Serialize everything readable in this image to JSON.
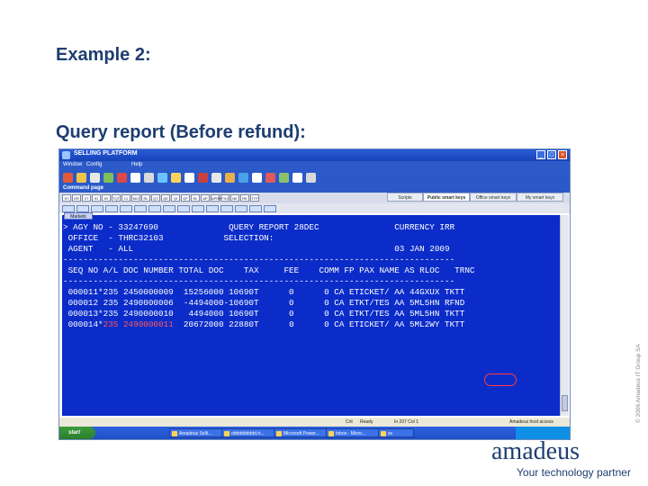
{
  "slide": {
    "title": "Example 2:",
    "subtitle": "Query report (Before refund):",
    "copyright": "© 2006 Amadeus IT Group SA",
    "logo": "amadeus",
    "tagline": "Your technology partner"
  },
  "window": {
    "title": "SELLING PLATFORM",
    "menu": [
      "Window",
      "Config",
      "Help"
    ],
    "command_page": "Command page",
    "function_keys": [
      "ST",
      "ER",
      "XT",
      "IG",
      "IR",
      "TQT",
      "CI",
      "MO",
      "RL",
      "QT",
      "QE",
      "QI",
      "QF",
      "RL",
      "AP",
      "APRK",
      "FXX",
      "NE",
      "RE",
      "TTP"
    ],
    "tabs": [
      "Scripts",
      "Public smart keys",
      "Office smart keys",
      "My smart keys"
    ],
    "subtab": "Markets",
    "terminal_lines": [
      "> AGY NO - 33247690              QUERY REPORT 28DEC               CURRENCY IRR",
      " OFFICE  - THRC32103            SELECTION:",
      " AGENT   - ALL                                                    03 JAN 2009",
      "------------------------------------------------------------------------------",
      " SEQ NO A/L DOC NUMBER TOTAL DOC    TAX     FEE    COMM FP PAX NAME AS RLOC   TRNC",
      "------------------------------------------------------------------------------",
      " 000011*235 2450000009  15256000 10690T      0      0 CA ETICKET/ AA 44GXUX TKTT",
      " 000012 235 2490000006  -4494000-10690T      0      0 CA ETKT/TES AA 5ML5HN RFND",
      " 000013*235 2490000010   4494000 10690T      0      0 CA ETKT/TES AA 5ML5HN TKTT"
    ],
    "last_line": {
      "seq": " 000014*",
      "red": "235 2490000011",
      "rest": "  20672000 22880T      0      0 CA ETICKET/ AA 5ML2WY TKTT"
    },
    "status": {
      "left": "Cnt",
      "ready": "Ready",
      "center": "In 207 Col 1",
      "right": "Amadeus host access"
    },
    "taskbar": {
      "start": "start",
      "tasks": [
        "Amadeus Selli...",
        "dddddddddd.rt...",
        "Microsoft Power...",
        "Inbox - Micro...",
        "ss"
      ],
      "clock": ""
    }
  }
}
